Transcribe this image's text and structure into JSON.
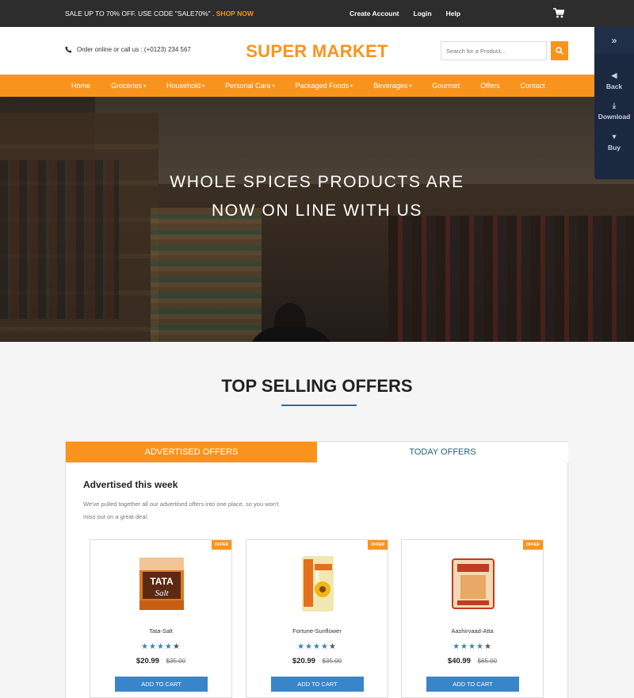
{
  "topbar": {
    "sale_text": "SALE UP TO 70% OFF. USE CODE \"SALE70%\" .",
    "shop_now": "SHOP NOW",
    "links": [
      "Create Account",
      "Login",
      "Help"
    ]
  },
  "header": {
    "call_text": "Order online or call us : (+0123) 234 567",
    "logo": "SUPER MARKET",
    "search_placeholder": "Search for a Product..."
  },
  "nav": {
    "items": [
      {
        "label": "Home",
        "dropdown": false
      },
      {
        "label": "Groceries",
        "dropdown": true
      },
      {
        "label": "Household",
        "dropdown": true
      },
      {
        "label": "Personal Care",
        "dropdown": true
      },
      {
        "label": "Packaged Foods",
        "dropdown": true
      },
      {
        "label": "Beverages",
        "dropdown": true
      },
      {
        "label": "Gourmet",
        "dropdown": false
      },
      {
        "label": "Offers",
        "dropdown": false
      },
      {
        "label": "Contact",
        "dropdown": false
      }
    ]
  },
  "hero": {
    "line1": "WHOLE SPICES PRODUCTS ARE",
    "line2": "NOW ON LINE WITH US"
  },
  "offers": {
    "title": "TOP SELLING OFFERS",
    "tabs": [
      "ADVERTISED OFFERS",
      "TODAY OFFERS"
    ],
    "adv_title": "Advertised this week",
    "adv_desc": "We've pulled together all our advertised offers into one place, so you won't miss out on a great deal.",
    "products": [
      {
        "name": "Tata-Salt",
        "price": "$20.99",
        "old_price": "$35.00",
        "rating": 4,
        "badge": "OFFER",
        "button": "ADD TO CART"
      },
      {
        "name": "Fortune-Sunflower",
        "price": "$20.99",
        "old_price": "$35.00",
        "rating": 4,
        "badge": "OFFER",
        "button": "ADD TO CART"
      },
      {
        "name": "Aashirvaad-Atta",
        "price": "$40.99",
        "old_price": "$65.00",
        "rating": 4,
        "badge": "OFFER",
        "button": "ADD TO CART"
      }
    ]
  },
  "side_panel": {
    "items": [
      "Back",
      "Download",
      "Buy"
    ]
  },
  "colors": {
    "accent": "#f8941e",
    "topbar": "#2d2d2d",
    "button_blue": "#3a84c9",
    "side_panel": "#1b2940"
  }
}
